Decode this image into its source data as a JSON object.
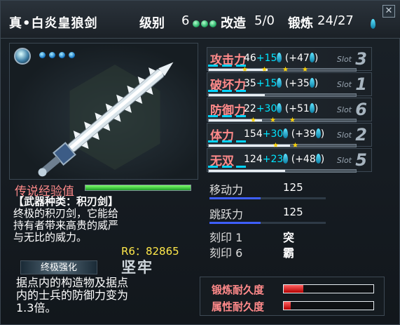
{
  "window": {
    "title": "真•白炎皇狼剑",
    "level_label": "级别",
    "level_value": "6",
    "modify_label": "改造",
    "modify_value": "5/0",
    "forge_label": "锻炼",
    "forge_value": "24/27",
    "close_label": "✕"
  },
  "stats": [
    {
      "name": "攻击力",
      "base": "46",
      "plus": "+15",
      "paren": "(+47",
      "slot_num": "3"
    },
    {
      "name": "破坏力",
      "base": "35",
      "plus": "+15",
      "paren": "(+35",
      "slot_num": "1"
    },
    {
      "name": "防御力",
      "base": "22",
      "plus": "+30",
      "paren": "(+51",
      "slot_num": "6"
    },
    {
      "name": "体力",
      "base": "154",
      "plus": "+30",
      "paren": "(+39",
      "slot_num": "2"
    },
    {
      "name": "无双",
      "base": "124",
      "plus": "+23",
      "paren": "(+48",
      "slot_num": "5"
    }
  ],
  "slot_label": "Slot",
  "close_paren": ")",
  "movement": {
    "label": "移动力",
    "value": "125"
  },
  "jump": {
    "label": "跳跃力",
    "value": "125"
  },
  "seals": [
    {
      "label": "刻印 1",
      "value": "突"
    },
    {
      "label": "刻印 6",
      "value": "霸"
    }
  ],
  "legend_exp_label": "传说经验值",
  "legend_exp_level": 1.0,
  "desc": {
    "line1": "【武器种类：积刃剑】",
    "line2": "终极的积刃剑，它能给",
    "line3": "持有者带来高贵的威严",
    "line4": "与无比的威力。"
  },
  "r6": "R6：82865",
  "ultimate": {
    "label": "终极强化",
    "name": "坚牢",
    "desc1": "据点内的构造物及据点",
    "desc2": "内的士兵的防御力变为",
    "desc3": "1.3倍。"
  },
  "durability": [
    {
      "label": "锻炼耐久度",
      "fill": 0.22
    },
    {
      "label": "属性耐久度",
      "fill": 0.08
    }
  ],
  "colors": {
    "accent": "#00e5ff",
    "stat_name": "#ff8a8a",
    "yellow": "#ffe84a"
  }
}
